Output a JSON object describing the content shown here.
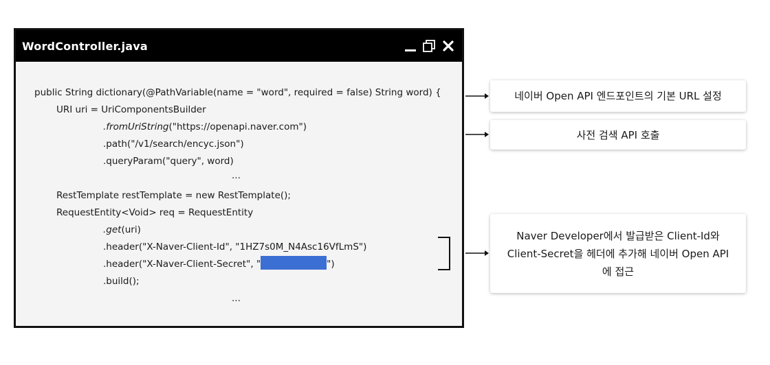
{
  "window": {
    "title": "WordController.java",
    "controls": {
      "minimize_icon": "minimize-icon",
      "restore_icon": "restore-icon",
      "close_icon": "close-icon"
    }
  },
  "code": {
    "lines": [
      "public String dictionary(@PathVariable(name = \"word\", required = false) String word) {",
      "URI uri = UriComponentsBuilder",
      ".fromUriString",
      "(\"https://openapi.naver.com\")",
      ".path(\"/v1/search/encyc.json\")",
      ".queryParam(\"query\", word)",
      "...",
      "RestTemplate restTemplate = new RestTemplate();",
      "RequestEntity<Void> req = RequestEntity",
      ".get",
      "(uri)",
      ".header(\"X-Naver-Client-Id\", \"1HZ7s0M_N4Asc16VfLmS\")",
      ".header(\"X-Naver-Client-Secret\", \"",
      "\")",
      ".build();",
      "..."
    ]
  },
  "annotations": [
    "네이버 Open API 엔드포인트의 기본 URL 설정",
    "사전 검색 API 호출",
    "Naver Developer에서 발급받은 Client-Id와 Client-Secret을 헤더에 추가해 네이버 Open API에 접근"
  ],
  "colors": {
    "redaction": "#3c6fd3",
    "titlebar": "#000000"
  }
}
